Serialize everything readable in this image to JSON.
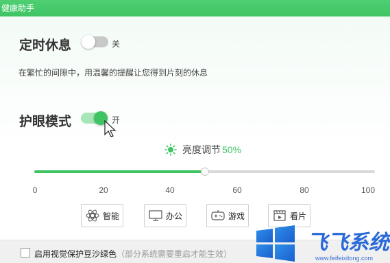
{
  "window": {
    "title": "健康助手"
  },
  "timed_rest": {
    "title": "定时休息",
    "toggle_state": "关",
    "description": "在繁忙的间隙中，用温馨的提醒让您得到片刻的休息"
  },
  "eye_protect": {
    "title": "护眼模式",
    "toggle_state": "开",
    "brightness_label": "亮度调节",
    "brightness_value": "50%",
    "brightness_percent": 50,
    "ticks": [
      "0",
      "20",
      "40",
      "60",
      "80",
      "100"
    ]
  },
  "modes": [
    {
      "label": "智能",
      "icon": "smart-icon"
    },
    {
      "label": "办公",
      "icon": "monitor-icon"
    },
    {
      "label": "游戏",
      "icon": "gamepad-icon"
    },
    {
      "label": "看片",
      "icon": "film-icon"
    }
  ],
  "bottom": {
    "checkbox_label": "启用视觉保护豆沙绿色",
    "checkbox_note": "（部分系统需要重启才能生效）"
  },
  "watermark": {
    "url": "www.feifeixitong.com"
  },
  "colors": {
    "accent": "#3fc464",
    "titlebar": "#4fcf72"
  }
}
